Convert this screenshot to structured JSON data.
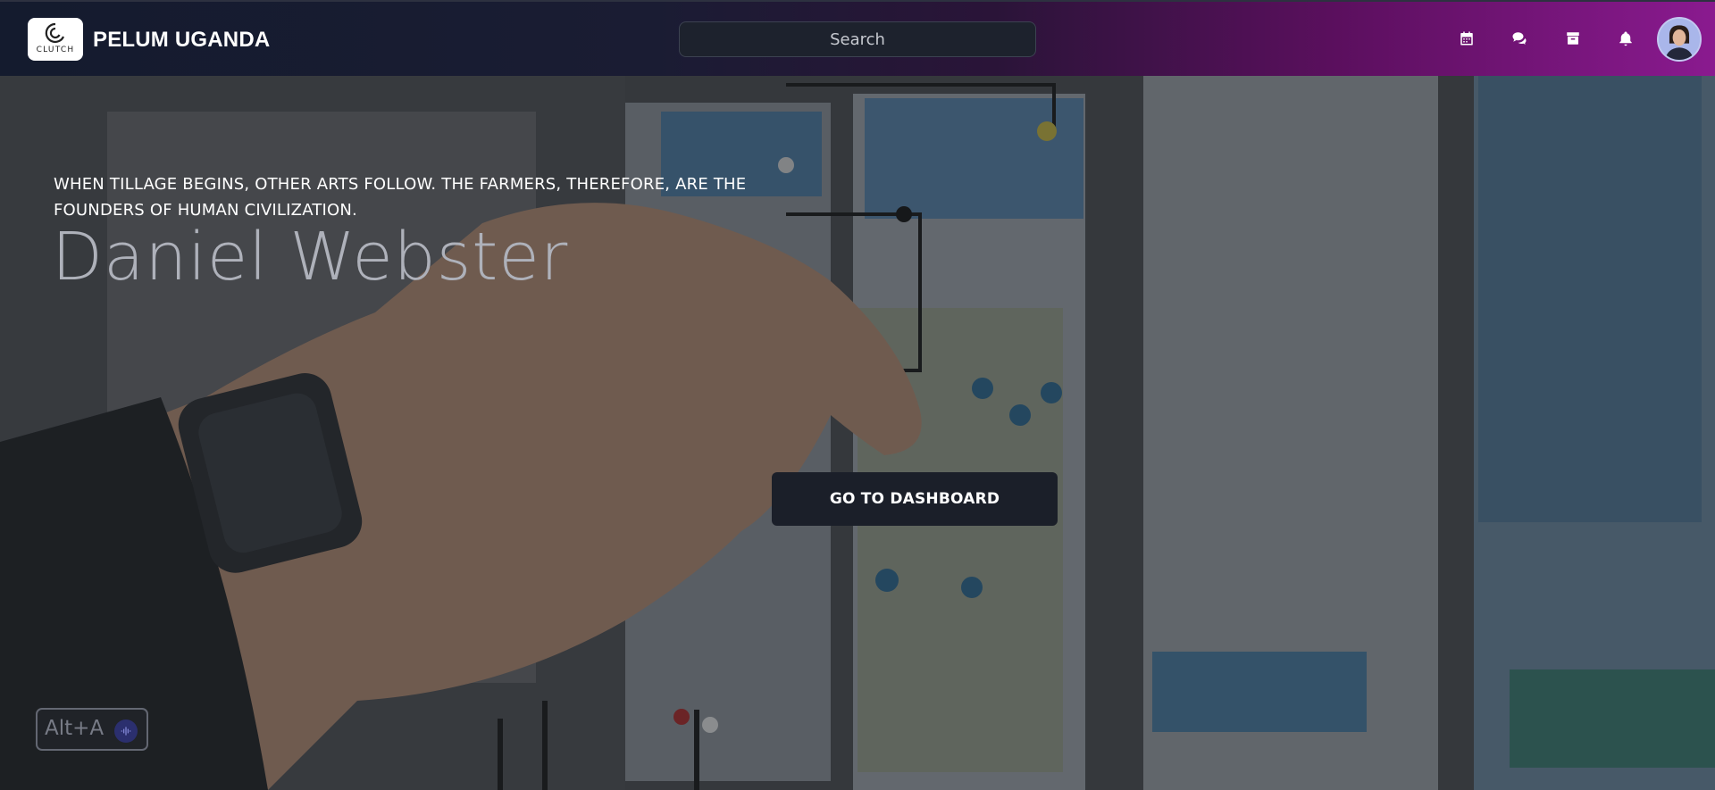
{
  "topbar": {
    "logo_text": "CLUTCH",
    "brand": "PELUM UGANDA",
    "search_placeholder": "Search",
    "icons": [
      "calendar-icon",
      "chat-icon",
      "archive-icon",
      "bell-icon"
    ]
  },
  "hero": {
    "quote": "WHEN TILLAGE BEGINS, OTHER ARTS FOLLOW. THE FARMERS, THEREFORE, ARE THE FOUNDERS OF HUMAN CIVILIZATION.",
    "author": "Daniel Webster",
    "cta_label": "GO TO DASHBOARD"
  },
  "shortcut_badge": {
    "label": "Alt+A"
  },
  "colors": {
    "topbar_start": "#141b2e",
    "topbar_end": "#8a1a8f",
    "cta_bg": "#1b1f29"
  }
}
